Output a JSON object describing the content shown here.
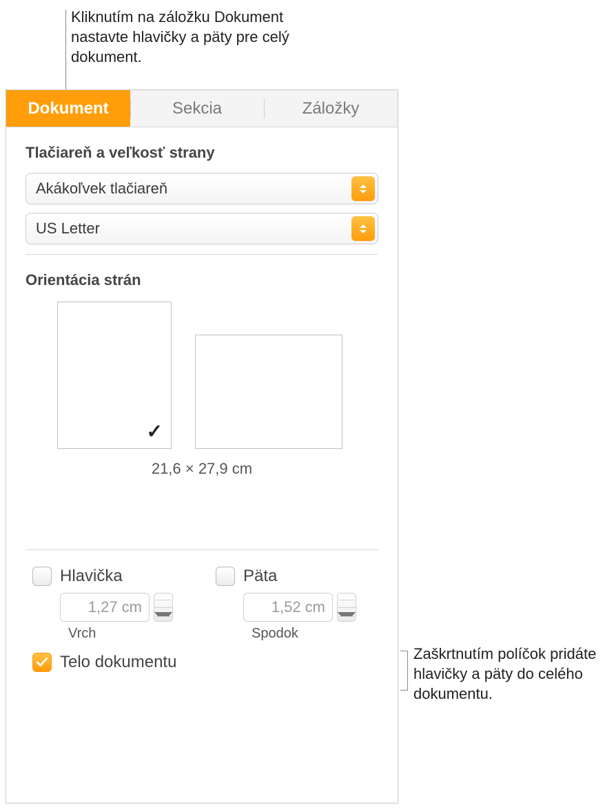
{
  "callouts": {
    "top": "Kliknutím na záložku Dokument nastavte hlavičky a päty pre celý dokument.",
    "right": "Zaškrtnutím políčok pridáte hlavičky a päty do celého dokumentu."
  },
  "tabs": {
    "document": "Dokument",
    "section": "Sekcia",
    "bookmarks": "Záložky"
  },
  "printer_section": {
    "title": "Tlačiareň a veľkosť strany",
    "printer_value": "Akákoľvek tlačiareň",
    "size_value": "US Letter"
  },
  "orientation": {
    "title": "Orientácia strán",
    "dimensions": "21,6 × 27,9 cm",
    "selected": "portrait"
  },
  "header": {
    "label": "Hlavička",
    "checked": false,
    "value": "1,27 cm",
    "sublabel": "Vrch"
  },
  "footer": {
    "label": "Päta",
    "checked": false,
    "value": "1,52 cm",
    "sublabel": "Spodok"
  },
  "document_body": {
    "label": "Telo dokumentu",
    "checked": true
  }
}
